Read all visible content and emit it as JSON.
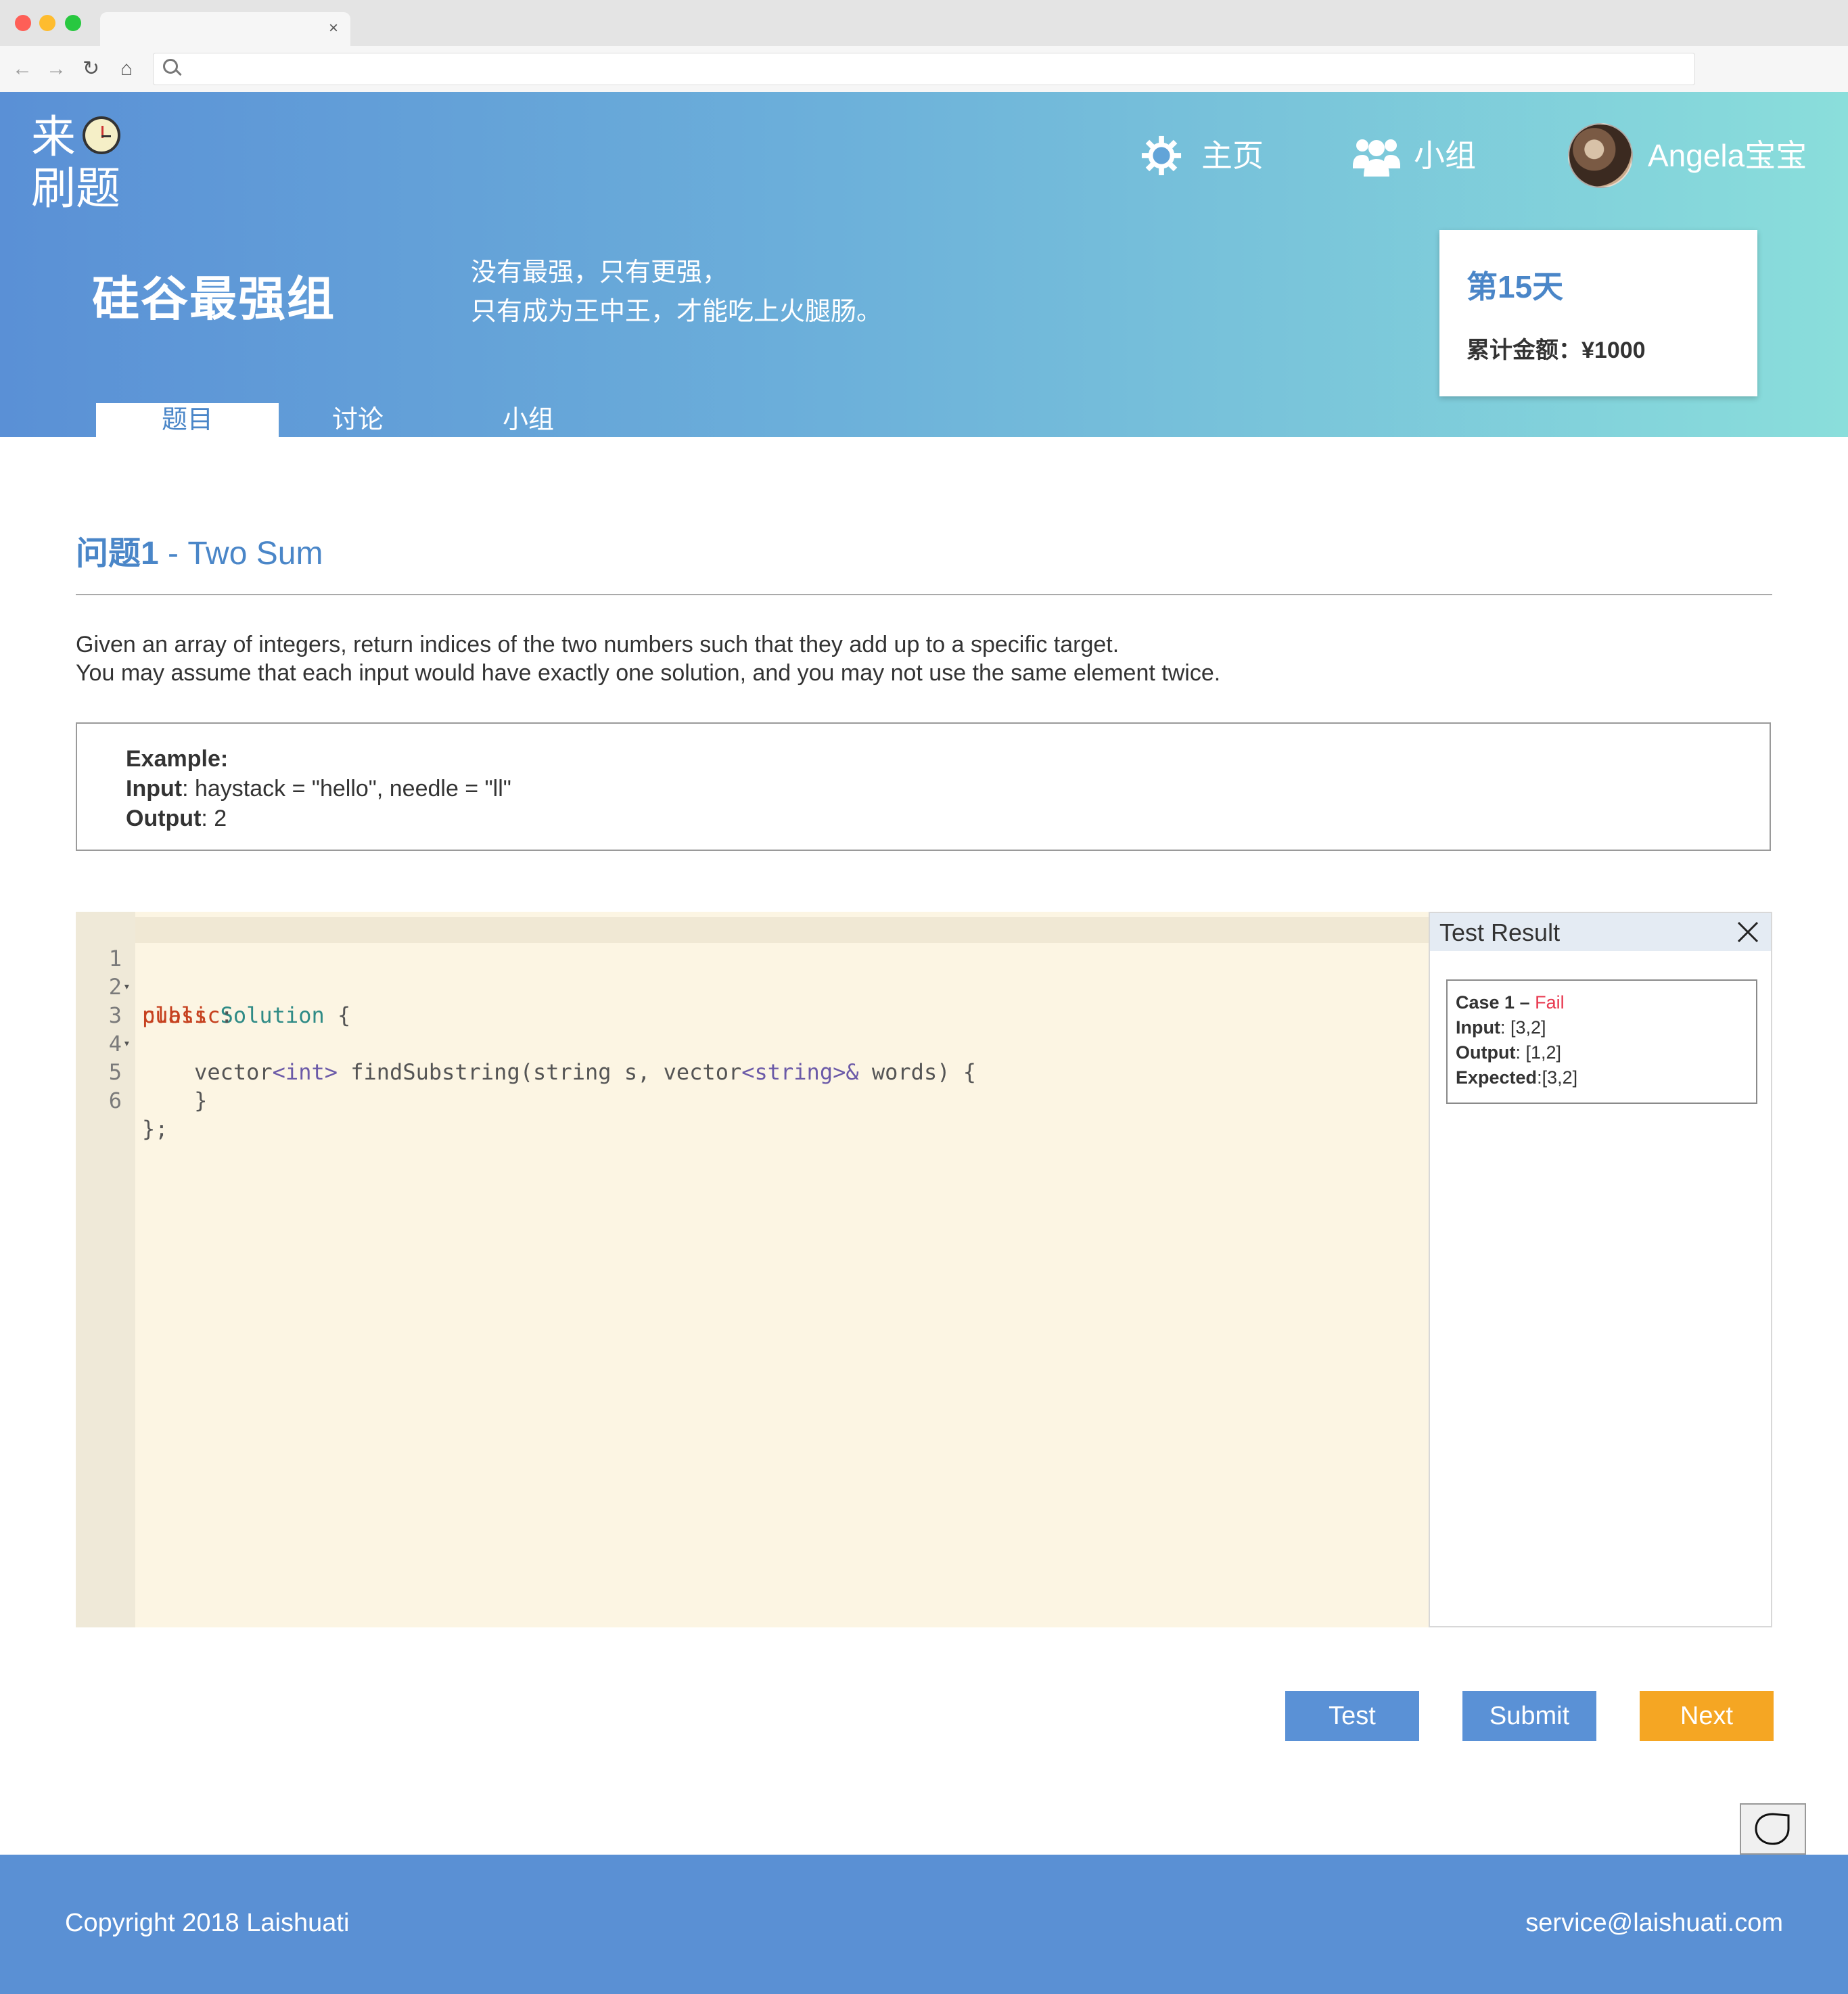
{
  "browser": {
    "tab_close": "×",
    "url_value": "",
    "url_placeholder": ""
  },
  "header": {
    "logo_line1": "来",
    "logo_line2": "刷题",
    "nav": {
      "home": "主页",
      "group": "小组",
      "user": "Angela宝宝"
    },
    "group_title": "硅谷最强组",
    "motto_line1": "没有最强，只有更强，",
    "motto_line2": "只有成为王中王，才能吃上火腿肠。",
    "card": {
      "day": "第15天",
      "amount": "累计金额：¥1000"
    },
    "tabs": [
      "题目",
      "讨论",
      "小组"
    ],
    "active_tab": "题目"
  },
  "problem": {
    "title_prefix": "问题1",
    "title_rest": " - Two Sum",
    "desc_line1": "Given an array of integers, return indices of the two numbers such that they add up to a specific target.",
    "desc_line2": "You may assume that each input would have exactly one solution, and you may not use the same element twice.",
    "example": {
      "heading": "Example:",
      "input_label": "Input",
      "input_value": ": haystack = \"hello\", needle = \"ll\"",
      "output_label": "Output",
      "output_value": ": 2"
    }
  },
  "editor": {
    "lines": [
      {
        "n": "1",
        "fold": "▾"
      },
      {
        "n": "2",
        "fold": ""
      },
      {
        "n": "3",
        "fold": "▾"
      },
      {
        "n": "4",
        "fold": ""
      },
      {
        "n": "5",
        "fold": ""
      },
      {
        "n": "6",
        "fold": ""
      }
    ],
    "tokens": {
      "l1_kw": "class",
      "l1_cls": " Solution",
      "l1_rest": " {",
      "l2_kw": "public",
      "l2_rest": ":",
      "l3_a": "    vector",
      "l3_ty1": "<int>",
      "l3_b": " findSubstring(string s, vector",
      "l3_ty2": "<string>&",
      "l3_c": " words) {",
      "l5": "    }",
      "l6": "};"
    }
  },
  "result": {
    "title": "Test Result",
    "case_label": "Case 1 – ",
    "case_status": "Fail",
    "input_label": "Input",
    "input_value": ": [3,2]",
    "output_label": "Output",
    "output_value": ": [1,2]",
    "expected_label": "Expected",
    "expected_value": ":[3,2]"
  },
  "actions": {
    "test": "Test",
    "submit": "Submit",
    "next": "Next"
  },
  "footer": {
    "copyright": "Copyright 2018 Laishuati",
    "email": "service@laishuati.com"
  },
  "colors": {
    "primary": "#5a91d6",
    "accent": "#f5a623",
    "fail": "#e8384f"
  }
}
